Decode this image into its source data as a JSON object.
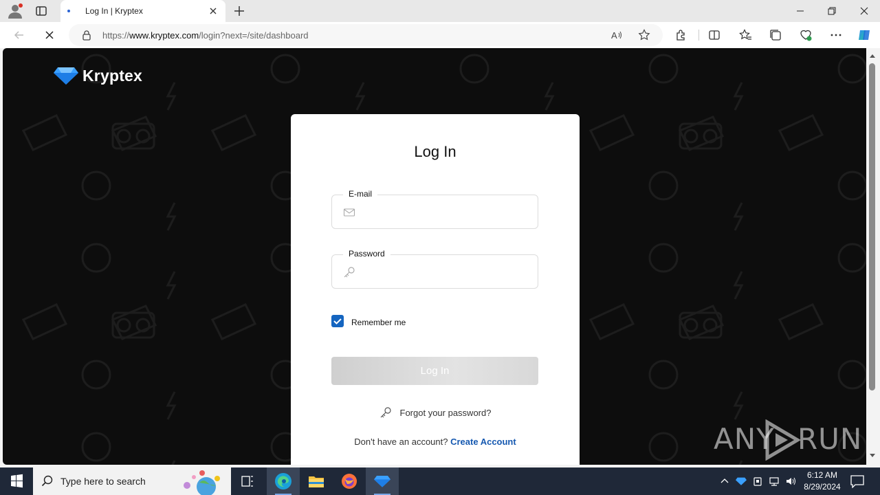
{
  "browser": {
    "tab": {
      "title": "Log In | Kryptex"
    },
    "address": {
      "prefix": "https://",
      "host": "www.kryptex.com",
      "path": "/login?next=/site/dashboard"
    }
  },
  "page": {
    "brand": "Kryptex",
    "card": {
      "title": "Log In",
      "email": {
        "label": "E-mail",
        "value": ""
      },
      "password": {
        "label": "Password",
        "value": ""
      },
      "remember": {
        "label": "Remember me",
        "checked": true
      },
      "login_button": "Log In",
      "forgot_link": "Forgot your password?",
      "signup_prompt": "Don't have an account?",
      "signup_link": "Create Account"
    },
    "watermark": {
      "left": "ANY",
      "right": "RUN"
    }
  },
  "taskbar": {
    "search_placeholder": "Type here to search",
    "time": "6:12 AM",
    "date": "8/29/2024"
  },
  "colors": {
    "accent": "#1565c0",
    "link": "#1558b0",
    "page_bg": "#0d0d0d",
    "gem_blue": "#3aa0ff"
  }
}
